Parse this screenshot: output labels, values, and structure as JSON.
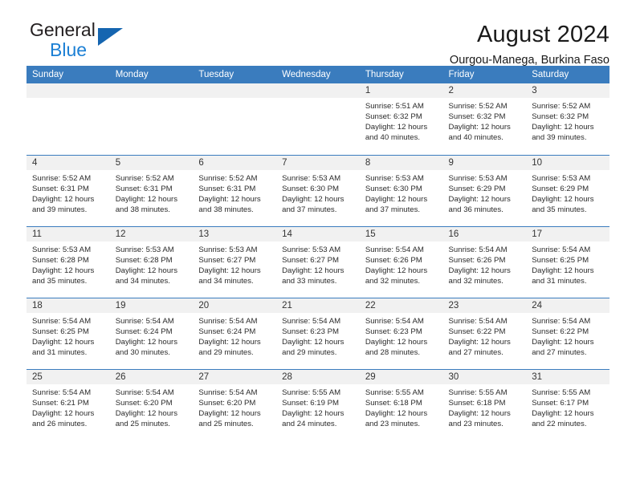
{
  "brand": {
    "name_top": "General",
    "name_bottom": "Blue",
    "triangle_color": "#1565b0",
    "blue_text_color": "#1b7fd4"
  },
  "header": {
    "title": "August 2024",
    "subtitle": "Ourgou-Manega, Burkina Faso"
  },
  "theme": {
    "header_row_bg": "#3a7cbe",
    "header_row_text": "#ffffff",
    "daynum_bg": "#f1f1f1",
    "grid_line": "#3a7cbe"
  },
  "weekday_headers": [
    "Sunday",
    "Monday",
    "Tuesday",
    "Wednesday",
    "Thursday",
    "Friday",
    "Saturday"
  ],
  "weeks": [
    [
      {
        "day": "",
        "empty": true
      },
      {
        "day": "",
        "empty": true
      },
      {
        "day": "",
        "empty": true
      },
      {
        "day": "",
        "empty": true
      },
      {
        "day": "1",
        "sunrise": "Sunrise: 5:51 AM",
        "sunset": "Sunset: 6:32 PM",
        "daylight": "Daylight: 12 hours and 40 minutes."
      },
      {
        "day": "2",
        "sunrise": "Sunrise: 5:52 AM",
        "sunset": "Sunset: 6:32 PM",
        "daylight": "Daylight: 12 hours and 40 minutes."
      },
      {
        "day": "3",
        "sunrise": "Sunrise: 5:52 AM",
        "sunset": "Sunset: 6:32 PM",
        "daylight": "Daylight: 12 hours and 39 minutes."
      }
    ],
    [
      {
        "day": "4",
        "sunrise": "Sunrise: 5:52 AM",
        "sunset": "Sunset: 6:31 PM",
        "daylight": "Daylight: 12 hours and 39 minutes."
      },
      {
        "day": "5",
        "sunrise": "Sunrise: 5:52 AM",
        "sunset": "Sunset: 6:31 PM",
        "daylight": "Daylight: 12 hours and 38 minutes."
      },
      {
        "day": "6",
        "sunrise": "Sunrise: 5:52 AM",
        "sunset": "Sunset: 6:31 PM",
        "daylight": "Daylight: 12 hours and 38 minutes."
      },
      {
        "day": "7",
        "sunrise": "Sunrise: 5:53 AM",
        "sunset": "Sunset: 6:30 PM",
        "daylight": "Daylight: 12 hours and 37 minutes."
      },
      {
        "day": "8",
        "sunrise": "Sunrise: 5:53 AM",
        "sunset": "Sunset: 6:30 PM",
        "daylight": "Daylight: 12 hours and 37 minutes."
      },
      {
        "day": "9",
        "sunrise": "Sunrise: 5:53 AM",
        "sunset": "Sunset: 6:29 PM",
        "daylight": "Daylight: 12 hours and 36 minutes."
      },
      {
        "day": "10",
        "sunrise": "Sunrise: 5:53 AM",
        "sunset": "Sunset: 6:29 PM",
        "daylight": "Daylight: 12 hours and 35 minutes."
      }
    ],
    [
      {
        "day": "11",
        "sunrise": "Sunrise: 5:53 AM",
        "sunset": "Sunset: 6:28 PM",
        "daylight": "Daylight: 12 hours and 35 minutes."
      },
      {
        "day": "12",
        "sunrise": "Sunrise: 5:53 AM",
        "sunset": "Sunset: 6:28 PM",
        "daylight": "Daylight: 12 hours and 34 minutes."
      },
      {
        "day": "13",
        "sunrise": "Sunrise: 5:53 AM",
        "sunset": "Sunset: 6:27 PM",
        "daylight": "Daylight: 12 hours and 34 minutes."
      },
      {
        "day": "14",
        "sunrise": "Sunrise: 5:53 AM",
        "sunset": "Sunset: 6:27 PM",
        "daylight": "Daylight: 12 hours and 33 minutes."
      },
      {
        "day": "15",
        "sunrise": "Sunrise: 5:54 AM",
        "sunset": "Sunset: 6:26 PM",
        "daylight": "Daylight: 12 hours and 32 minutes."
      },
      {
        "day": "16",
        "sunrise": "Sunrise: 5:54 AM",
        "sunset": "Sunset: 6:26 PM",
        "daylight": "Daylight: 12 hours and 32 minutes."
      },
      {
        "day": "17",
        "sunrise": "Sunrise: 5:54 AM",
        "sunset": "Sunset: 6:25 PM",
        "daylight": "Daylight: 12 hours and 31 minutes."
      }
    ],
    [
      {
        "day": "18",
        "sunrise": "Sunrise: 5:54 AM",
        "sunset": "Sunset: 6:25 PM",
        "daylight": "Daylight: 12 hours and 31 minutes."
      },
      {
        "day": "19",
        "sunrise": "Sunrise: 5:54 AM",
        "sunset": "Sunset: 6:24 PM",
        "daylight": "Daylight: 12 hours and 30 minutes."
      },
      {
        "day": "20",
        "sunrise": "Sunrise: 5:54 AM",
        "sunset": "Sunset: 6:24 PM",
        "daylight": "Daylight: 12 hours and 29 minutes."
      },
      {
        "day": "21",
        "sunrise": "Sunrise: 5:54 AM",
        "sunset": "Sunset: 6:23 PM",
        "daylight": "Daylight: 12 hours and 29 minutes."
      },
      {
        "day": "22",
        "sunrise": "Sunrise: 5:54 AM",
        "sunset": "Sunset: 6:23 PM",
        "daylight": "Daylight: 12 hours and 28 minutes."
      },
      {
        "day": "23",
        "sunrise": "Sunrise: 5:54 AM",
        "sunset": "Sunset: 6:22 PM",
        "daylight": "Daylight: 12 hours and 27 minutes."
      },
      {
        "day": "24",
        "sunrise": "Sunrise: 5:54 AM",
        "sunset": "Sunset: 6:22 PM",
        "daylight": "Daylight: 12 hours and 27 minutes."
      }
    ],
    [
      {
        "day": "25",
        "sunrise": "Sunrise: 5:54 AM",
        "sunset": "Sunset: 6:21 PM",
        "daylight": "Daylight: 12 hours and 26 minutes."
      },
      {
        "day": "26",
        "sunrise": "Sunrise: 5:54 AM",
        "sunset": "Sunset: 6:20 PM",
        "daylight": "Daylight: 12 hours and 25 minutes."
      },
      {
        "day": "27",
        "sunrise": "Sunrise: 5:54 AM",
        "sunset": "Sunset: 6:20 PM",
        "daylight": "Daylight: 12 hours and 25 minutes."
      },
      {
        "day": "28",
        "sunrise": "Sunrise: 5:55 AM",
        "sunset": "Sunset: 6:19 PM",
        "daylight": "Daylight: 12 hours and 24 minutes."
      },
      {
        "day": "29",
        "sunrise": "Sunrise: 5:55 AM",
        "sunset": "Sunset: 6:18 PM",
        "daylight": "Daylight: 12 hours and 23 minutes."
      },
      {
        "day": "30",
        "sunrise": "Sunrise: 5:55 AM",
        "sunset": "Sunset: 6:18 PM",
        "daylight": "Daylight: 12 hours and 23 minutes."
      },
      {
        "day": "31",
        "sunrise": "Sunrise: 5:55 AM",
        "sunset": "Sunset: 6:17 PM",
        "daylight": "Daylight: 12 hours and 22 minutes."
      }
    ]
  ]
}
